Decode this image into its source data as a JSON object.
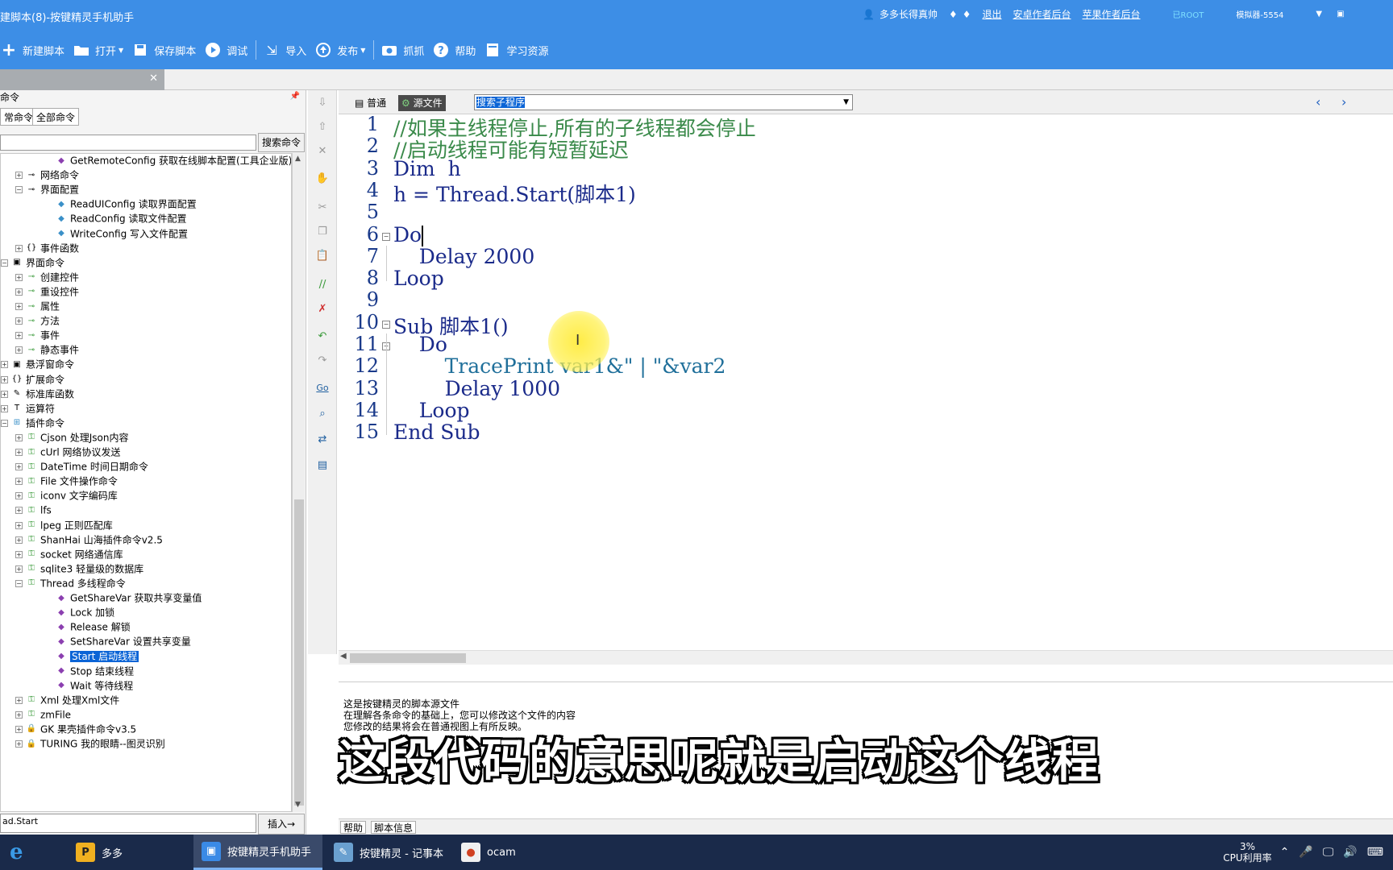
{
  "titlebar": {
    "title": "建脚本(8)-按键精灵手机助手",
    "user": "多多长得真帅",
    "logout": "退出",
    "android_backend": "安卓作者后台",
    "apple_backend": "苹果作者后台",
    "root_badge": "已ROOT",
    "emulator": "模拟器-5554"
  },
  "toolbar": {
    "items": [
      {
        "label": "新建脚本",
        "icon": "plus-icon"
      },
      {
        "label": "打开",
        "icon": "folder-icon",
        "dropdown": true
      },
      {
        "label": "保存脚本",
        "icon": "save-icon"
      },
      {
        "label": "调试",
        "icon": "play-icon"
      },
      {
        "label": "导入",
        "icon": "import-icon"
      },
      {
        "label": "发布",
        "icon": "publish-icon",
        "dropdown": true
      },
      {
        "label": "抓抓",
        "icon": "camera-icon"
      },
      {
        "label": "帮助",
        "icon": "help-icon"
      },
      {
        "label": "学习资源",
        "icon": "book-icon"
      }
    ]
  },
  "leftpanel": {
    "header": "命令",
    "tab_common": "常命令",
    "tab_all": "全部命令",
    "search_button": "搜索命令",
    "insert_value": "ad.Start",
    "insert_button": "插入→"
  },
  "tree": [
    {
      "label": "GetRemoteConfig 获取在线脚本配置(工具企业版)",
      "indent": 3,
      "icon": "gem"
    },
    {
      "label": "网络命令",
      "indent": 1,
      "icon": "key",
      "exp": "+"
    },
    {
      "label": "界面配置",
      "indent": 1,
      "icon": "key",
      "exp": "−"
    },
    {
      "label": "ReadUIConfig 读取界面配置",
      "indent": 3,
      "icon": "gem2"
    },
    {
      "label": "ReadConfig 读取文件配置",
      "indent": 3,
      "icon": "gem2"
    },
    {
      "label": "WriteConfig 写入文件配置",
      "indent": 3,
      "icon": "gem2"
    },
    {
      "label": "事件函数",
      "indent": 1,
      "icon": "brace",
      "exp": "+"
    },
    {
      "label": "界面命令",
      "indent": 0,
      "icon": "window",
      "exp": "−"
    },
    {
      "label": "创建控件",
      "indent": 1,
      "icon": "grn",
      "exp": "+"
    },
    {
      "label": "重设控件",
      "indent": 1,
      "icon": "grn",
      "exp": "+"
    },
    {
      "label": "属性",
      "indent": 1,
      "icon": "grn",
      "exp": "+"
    },
    {
      "label": "方法",
      "indent": 1,
      "icon": "grn",
      "exp": "+"
    },
    {
      "label": "事件",
      "indent": 1,
      "icon": "grn",
      "exp": "+"
    },
    {
      "label": "静态事件",
      "indent": 1,
      "icon": "grn",
      "exp": "+"
    },
    {
      "label": "悬浮窗命令",
      "indent": 0,
      "icon": "window",
      "exp": "+"
    },
    {
      "label": "扩展命令",
      "indent": 0,
      "icon": "brace",
      "exp": "+"
    },
    {
      "label": "标准库函数",
      "indent": 0,
      "icon": "edit",
      "exp": "+"
    },
    {
      "label": "运算符",
      "indent": 0,
      "icon": "T",
      "exp": "+"
    },
    {
      "label": "插件命令",
      "indent": 0,
      "icon": "plugin",
      "exp": "−"
    },
    {
      "label": "Cjson 处理Json内容",
      "indent": 1,
      "icon": "keys",
      "exp": "+"
    },
    {
      "label": "cUrl 网络协议发送",
      "indent": 1,
      "icon": "keys",
      "exp": "+"
    },
    {
      "label": "DateTime 时间日期命令",
      "indent": 1,
      "icon": "keys",
      "exp": "+"
    },
    {
      "label": "File 文件操作命令",
      "indent": 1,
      "icon": "keys",
      "exp": "+"
    },
    {
      "label": "iconv 文字编码库",
      "indent": 1,
      "icon": "keys",
      "exp": "+"
    },
    {
      "label": "lfs",
      "indent": 1,
      "icon": "keys",
      "exp": "+"
    },
    {
      "label": "lpeg 正则匹配库",
      "indent": 1,
      "icon": "keys",
      "exp": "+"
    },
    {
      "label": "ShanHai 山海插件命令v2.5",
      "indent": 1,
      "icon": "keys",
      "exp": "+"
    },
    {
      "label": "socket 网络通信库",
      "indent": 1,
      "icon": "keys",
      "exp": "+"
    },
    {
      "label": "sqlite3 轻量级的数据库",
      "indent": 1,
      "icon": "keys",
      "exp": "+"
    },
    {
      "label": "Thread 多线程命令",
      "indent": 1,
      "icon": "keys",
      "exp": "−"
    },
    {
      "label": "GetShareVar 获取共享变量值",
      "indent": 3,
      "icon": "gem"
    },
    {
      "label": "Lock 加锁",
      "indent": 3,
      "icon": "gem"
    },
    {
      "label": "Release 解锁",
      "indent": 3,
      "icon": "gem"
    },
    {
      "label": "SetShareVar 设置共享变量",
      "indent": 3,
      "icon": "gem"
    },
    {
      "label": "Start 启动线程",
      "indent": 3,
      "icon": "gem",
      "selected": true
    },
    {
      "label": "Stop 结束线程",
      "indent": 3,
      "icon": "gem"
    },
    {
      "label": "Wait 等待线程",
      "indent": 3,
      "icon": "gem"
    },
    {
      "label": "Xml 处理Xml文件",
      "indent": 1,
      "icon": "keys",
      "exp": "+"
    },
    {
      "label": "zmFile",
      "indent": 1,
      "icon": "keys",
      "exp": "+"
    },
    {
      "label": "GK 果壳插件命令v3.5",
      "indent": 1,
      "icon": "lock",
      "exp": "+"
    },
    {
      "label": "TURING 我的眼睛--图灵识别",
      "indent": 1,
      "icon": "lock",
      "exp": "+"
    }
  ],
  "editor": {
    "mode_normal": "普通",
    "mode_source": "源文件",
    "sub_select": "搜索子程序",
    "lines": [
      {
        "n": "1",
        "text": "//如果主线程停止,所有的子线程都会停止",
        "cls": "cmt"
      },
      {
        "n": "2",
        "text": "//启动线程可能有短暂延迟",
        "cls": "cmt"
      },
      {
        "n": "3",
        "text": "Dim  h",
        "cls": "kw"
      },
      {
        "n": "4",
        "text": "h = Thread.Start(脚本1)",
        "cls": "kw"
      },
      {
        "n": "5",
        "text": "",
        "cls": "kw"
      },
      {
        "n": "6",
        "text": "Do",
        "cls": "kw",
        "fold": "−",
        "caret": true
      },
      {
        "n": "7",
        "text": "    Delay 2000",
        "cls": "kw"
      },
      {
        "n": "8",
        "text": "Loop",
        "cls": "kw"
      },
      {
        "n": "9",
        "text": "",
        "cls": "kw"
      },
      {
        "n": "10",
        "text": "Sub 脚本1()",
        "cls": "kw",
        "fold": "−"
      },
      {
        "n": "11",
        "text": "    Do",
        "cls": "kw",
        "fold": "−"
      },
      {
        "n": "12",
        "text": "        TracePrint var1&\" | \"&var2",
        "cls": "fn"
      },
      {
        "n": "13",
        "text": "        Delay 1000",
        "cls": "kw"
      },
      {
        "n": "14",
        "text": "    Loop",
        "cls": "kw"
      },
      {
        "n": "15",
        "text": "End Sub",
        "cls": "kw"
      }
    ]
  },
  "info": {
    "line1": "这是按键精灵的脚本源文件",
    "line2": "在理解各条命令的基础上，您可以修改这个文件的内容",
    "line3": "您修改的结果将会在普通视图上有所反映。",
    "subtitle": "这段代码的意思呢就是启动这个线程",
    "tab_help": "帮助",
    "tab_info": "脚本信息"
  },
  "taskbar": {
    "items": [
      {
        "label": "多多"
      },
      {
        "label": "按键精灵手机助手",
        "active": true
      },
      {
        "label": "按键精灵 - 记事本"
      },
      {
        "label": "ocam"
      }
    ],
    "cpu_percent": "3%",
    "cpu_label": "CPU利用率"
  },
  "colors": {
    "accent": "#3d8ee6",
    "selection": "#0a64d6",
    "comment": "#3a8a4a",
    "code": "#1a3a8a"
  }
}
